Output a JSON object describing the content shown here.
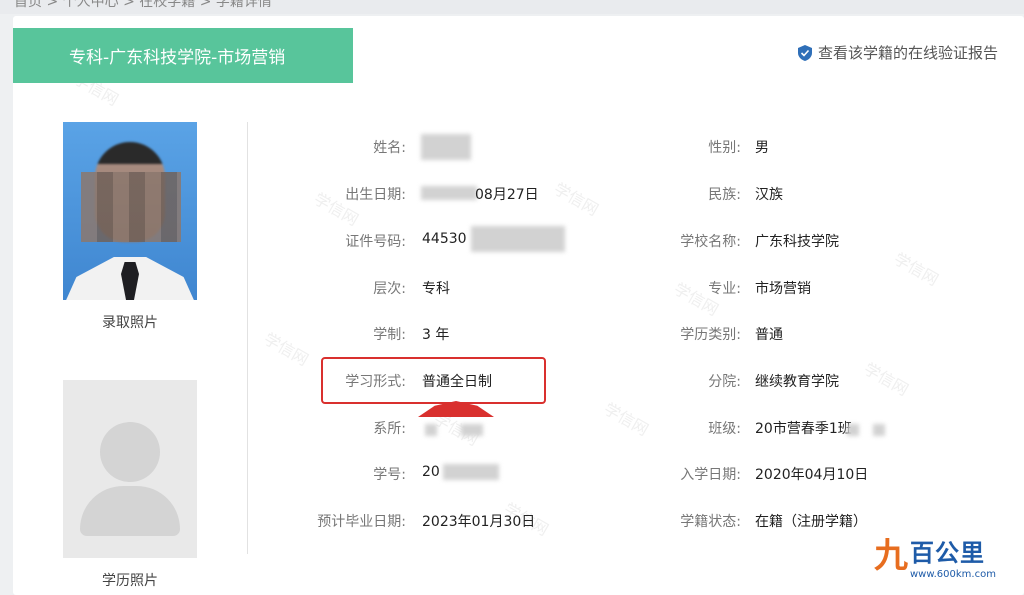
{
  "breadcrumb": "首页 > 个人中心 > 在校学籍 > 学籍详情",
  "header": {
    "title": "专科-广东科技学院-市场营销",
    "verify_link": "查看该学籍的在线验证报告"
  },
  "photos": {
    "admission_caption": "录取照片",
    "edu_caption": "学历照片"
  },
  "fields_left": [
    {
      "label": "姓名:",
      "value": ""
    },
    {
      "label": "出生日期:",
      "value": "08月27日"
    },
    {
      "label": "证件号码:",
      "value": "44530"
    },
    {
      "label": "层次:",
      "value": "专科"
    },
    {
      "label": "学制:",
      "value": "3 年"
    },
    {
      "label": "学习形式:",
      "value": "普通全日制"
    },
    {
      "label": "系所:",
      "value": ""
    },
    {
      "label": "学号:",
      "value": "20"
    },
    {
      "label": "预计毕业日期:",
      "value": "2023年01月30日"
    }
  ],
  "fields_right": [
    {
      "label": "性别:",
      "value": "男"
    },
    {
      "label": "民族:",
      "value": "汉族"
    },
    {
      "label": "学校名称:",
      "value": "广东科技学院"
    },
    {
      "label": "专业:",
      "value": "市场营销"
    },
    {
      "label": "学历类别:",
      "value": "普通"
    },
    {
      "label": "分院:",
      "value": "继续教育学院"
    },
    {
      "label": "班级:",
      "value": "20市营春季1班"
    },
    {
      "label": "入学日期:",
      "value": "2020年04月10日"
    },
    {
      "label": "学籍状态:",
      "value": "在籍（注册学籍）"
    }
  ],
  "watermark_text": "学信网",
  "logo": {
    "mark": "九",
    "brand": "百公里",
    "site": "www.600km.com"
  },
  "colors": {
    "header_bg": "#58c59b",
    "highlight": "#d9302e",
    "verify_icon": "#2f6fb8"
  }
}
